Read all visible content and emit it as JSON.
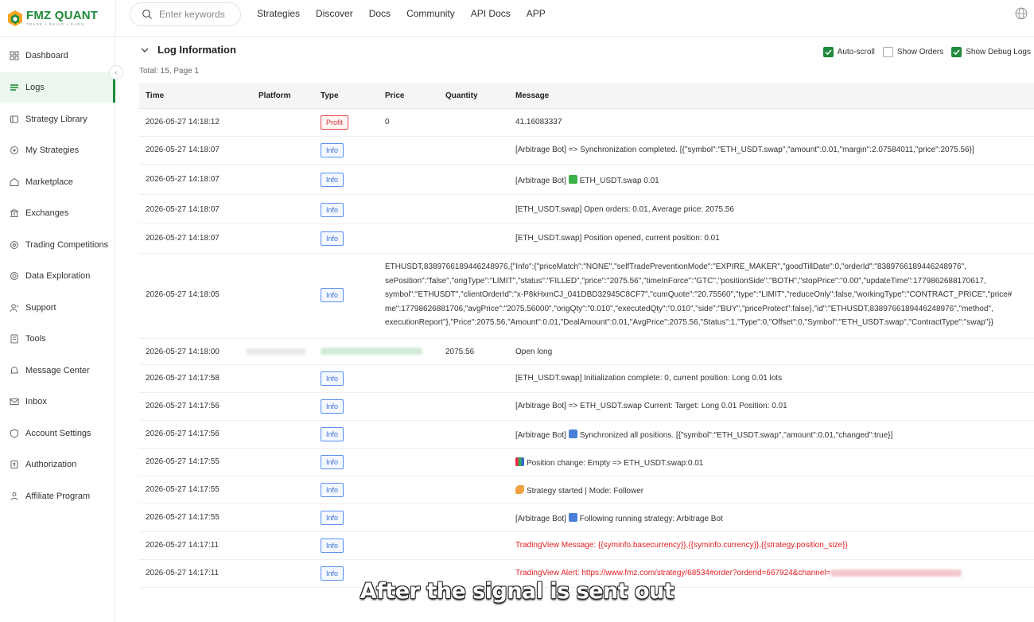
{
  "app": {
    "logo_title": "FMZ QUANT",
    "logo_tag": "TRADE • BUILD • EARN",
    "accent": "#1f8a3a"
  },
  "search": {
    "placeholder": "Enter keywords"
  },
  "nav": [
    "Strategies",
    "Discover",
    "Docs",
    "Community",
    "API Docs",
    "APP"
  ],
  "sidebar": {
    "items": [
      {
        "label": "Dashboard",
        "icon": "dashboard-icon"
      },
      {
        "label": "Logs",
        "icon": "logs-icon",
        "active": true
      },
      {
        "label": "Strategy Library",
        "icon": "library-icon"
      },
      {
        "label": "My Strategies",
        "icon": "strategies-icon"
      },
      {
        "label": "Marketplace",
        "icon": "marketplace-icon"
      },
      {
        "label": "Exchanges",
        "icon": "exchange-icon"
      },
      {
        "label": "Trading Competitions",
        "icon": "trophy-icon"
      },
      {
        "label": "Data Exploration",
        "icon": "explore-icon"
      },
      {
        "label": "Support",
        "icon": "support-icon"
      },
      {
        "label": "Tools",
        "icon": "tools-icon"
      },
      {
        "label": "Message Center",
        "icon": "bell-icon"
      },
      {
        "label": "Inbox",
        "icon": "mail-icon"
      },
      {
        "label": "Account Settings",
        "icon": "settings-icon"
      },
      {
        "label": "Authorization",
        "icon": "key-icon"
      },
      {
        "label": "Affiliate Program",
        "icon": "affiliate-icon"
      }
    ]
  },
  "panel": {
    "title": "Log Information",
    "total": "Total: 15, Page 1",
    "options": [
      {
        "label": "Auto-scroll",
        "checked": true
      },
      {
        "label": "Show Orders",
        "checked": false
      },
      {
        "label": "Show Debug Logs",
        "checked": true
      }
    ]
  },
  "table": {
    "headers": [
      "Time",
      "Platform",
      "Type",
      "Price",
      "Quantity",
      "Message"
    ],
    "rows": [
      {
        "time": "2026-05-27 14:18:12",
        "type": "Profit",
        "price": "0",
        "qty": "",
        "message": "41.16083337"
      },
      {
        "time": "2026-05-27 14:18:07",
        "type": "Info",
        "price": "",
        "qty": "",
        "message": "[Arbitrage Bot] => Synchronization completed. [{\"symbol\":\"ETH_USDT.swap\",\"amount\":0.01,\"margin\":2.07584011,\"price\":2075.56}]"
      },
      {
        "time": "2026-05-27 14:18:07",
        "type": "Info",
        "price": "",
        "qty": "",
        "message_prefix": "[Arbitrage Bot]",
        "message": "ETH_USDT.swap 0.01"
      },
      {
        "time": "2026-05-27 14:18:07",
        "type": "Info",
        "price": "",
        "qty": "",
        "message": "[ETH_USDT.swap] Open orders: 0.01, Average price: 2075.56"
      },
      {
        "time": "2026-05-27 14:18:07",
        "type": "Info",
        "price": "",
        "qty": "",
        "message": "[ETH_USDT.swap] Position opened, current position: 0.01"
      },
      {
        "time": "2026-05-27 14:18:05",
        "type": "Info",
        "lines": [
          "ETHUSDT,8389766189446248976,{\"Info\":{\"priceMatch\":\"NONE\",\"selfTradePreventionMode\":\"EXPIRE_MAKER\",\"goodTillDate\":0,\"orderId\":\"8389766189446248976\",",
          "sePosition\":\"false\",\"origType\":\"LIMIT\",\"status\":\"FILLED\",\"price\":\"2075.56\",\"timeInForce\":\"GTC\",\"positionSide\":\"BOTH\",\"stopPrice\":\"0.00\",\"updateTime\":1779862688170617,",
          "symbol\":\"ETHUSDT\",\"clientOrderId\":\"x-P8kHxmCJ_041DBD32945C8CF7\",\"cumQuote\":\"20.75560\",\"type\":\"LIMIT\",\"reduceOnly\":false,\"workingType\":\"CONTRACT_PRICE\",\"price#",
          "me\":17798626881706,\"avgPrice\":\"2075.56000\",\"origQty\":\"0.010\",\"executedQty\":\"0.010\",\"side\":\"BUY\",\"priceProtect\":false},\"id\":\"ETHUSDT,8389766189446248976\",\"method\",",
          "executionReport\"},\"Price\":2075.56,\"Amount\":0.01,\"DealAmount\":0.01,\"AvgPrice\":2075.56,\"Status\":1,\"Type\":0,\"Offset\":0,\"Symbol\":\"ETH_USDT.swap\",\"ContractType\":\"swap\"}}"
        ]
      },
      {
        "time": "2026-05-27 14:18:00",
        "type": "",
        "price": "",
        "qty": "2075.56",
        "message": "Open long"
      },
      {
        "time": "2026-05-27 14:17:58",
        "type": "Info",
        "message": "[ETH_USDT.swap] Initialization complete: 0, current position: Long 0.01 lots"
      },
      {
        "time": "2026-05-27 14:17:56",
        "type": "Info",
        "message": "[Arbitrage Bot] => ETH_USDT.swap Current: Target: Long 0.01 Position: 0.01"
      },
      {
        "time": "2026-05-27 14:17:56",
        "type": "Info",
        "message_prefix": "[Arbitrage Bot]",
        "message": "Synchronized all positions. [{\"symbol\":\"ETH_USDT.swap\",\"amount\":0.01,\"changed\":true}]"
      },
      {
        "time": "2026-05-27 14:17:55",
        "type": "Info",
        "message": "Position change: Empty => ETH_USDT.swap:0.01"
      },
      {
        "time": "2026-05-27 14:17:55",
        "type": "Info",
        "message": "Strategy started | Mode: Follower"
      },
      {
        "time": "2026-05-27 14:17:55",
        "type": "Info",
        "message_prefix": "[Arbitrage Bot]",
        "message": "Following running strategy: Arbitrage Bot"
      },
      {
        "time": "2026-05-27 14:17:11",
        "type": "Info",
        "message": "TradingView Message: {{syminfo.basecurrency}},{{syminfo.currency}},{{strategy.position_size}}"
      },
      {
        "time": "2026-05-27 14:17:11",
        "type": "Info",
        "message": "TradingView Alert: https://www.fmz.com/strategy/68534#order?orderid=667924&channel="
      }
    ]
  },
  "caption": "After the signal is sent out"
}
